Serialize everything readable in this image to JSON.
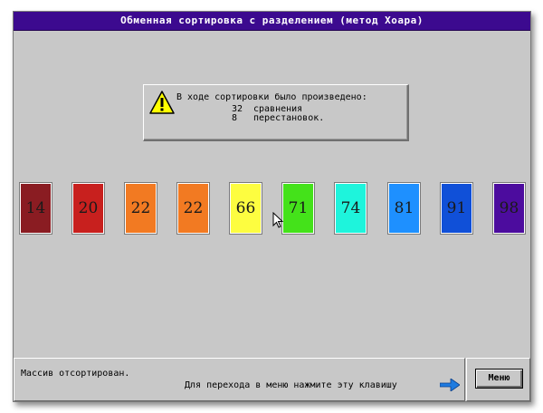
{
  "window": {
    "title": "Обменная сортировка с разделением (метод Хоара)"
  },
  "dialog": {
    "heading": "В ходе сортировки было произведено:",
    "comparisons": {
      "value": "32",
      "label": "сравнения"
    },
    "swaps": {
      "value": "8",
      "label": "перестановок."
    },
    "icon": "warning-icon"
  },
  "cards": [
    {
      "value": "14",
      "color": "#8a1c22"
    },
    {
      "value": "20",
      "color": "#c8201e"
    },
    {
      "value": "22",
      "color": "#f27a22"
    },
    {
      "value": "22",
      "color": "#f27a22"
    },
    {
      "value": "66",
      "color": "#fdfd40"
    },
    {
      "value": "71",
      "color": "#44e21a"
    },
    {
      "value": "74",
      "color": "#1ef4dc"
    },
    {
      "value": "81",
      "color": "#1e90ff"
    },
    {
      "value": "91",
      "color": "#1050d8"
    },
    {
      "value": "98",
      "color": "#4c0c9e"
    }
  ],
  "status": {
    "message": "Массив отсортирован.",
    "hint": "Для перехода в меню нажмите эту клавишу",
    "hint_icon": "arrow-right-icon"
  },
  "menu_button": {
    "label": "Меню"
  }
}
